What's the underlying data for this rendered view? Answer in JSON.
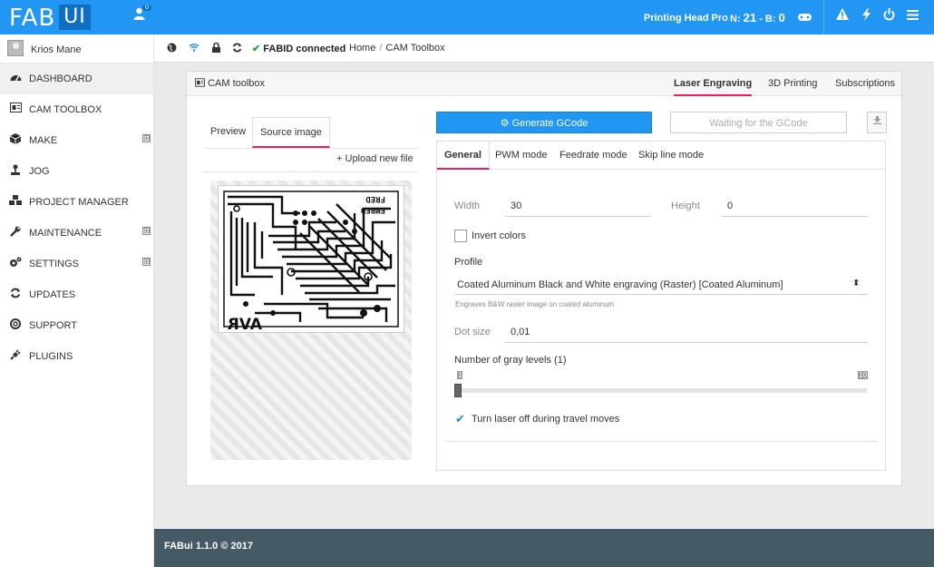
{
  "header": {
    "logo_main": "FAB",
    "logo_ui": "UI",
    "notification_count": "0",
    "head_name": "Printing Head Pro",
    "temp_n_label": "N:",
    "temp_n_value": "21",
    "temp_b_label": "B:",
    "temp_b_value": "0"
  },
  "sidebar": {
    "user_name": "Krios Mane",
    "items": [
      {
        "label": "DASHBOARD",
        "icon": "dashboard-icon",
        "expandable": false
      },
      {
        "label": "CAM TOOLBOX",
        "icon": "cam-toolbox-icon",
        "expandable": false
      },
      {
        "label": "MAKE",
        "icon": "cube-icon",
        "expandable": true
      },
      {
        "label": "JOG",
        "icon": "joystick-icon",
        "expandable": false
      },
      {
        "label": "PROJECT MANAGER",
        "icon": "cubes-icon",
        "expandable": false
      },
      {
        "label": "MAINTENANCE",
        "icon": "wrench-icon",
        "expandable": true
      },
      {
        "label": "SETTINGS",
        "icon": "cogs-icon",
        "expandable": true
      },
      {
        "label": "UPDATES",
        "icon": "refresh-icon",
        "expandable": false
      },
      {
        "label": "SUPPORT",
        "icon": "lifebuoy-icon",
        "expandable": false
      },
      {
        "label": "PLUGINS",
        "icon": "plug-icon",
        "expandable": false
      }
    ],
    "expand_glyph": "⊞"
  },
  "crumbbar": {
    "fabid": "FABID connected",
    "crumbs": [
      "Home",
      "CAM Toolbox"
    ]
  },
  "panel": {
    "title": "CAM toolbox",
    "tabs": [
      "Laser Engraving",
      "3D Printing",
      "Subscriptions"
    ],
    "active_tab": "Laser Engraving"
  },
  "left": {
    "tabs": [
      "Preview",
      "Source image"
    ],
    "upload_label": "Upload new file"
  },
  "actions": {
    "generate": "Generate GCode",
    "waiting": "Waiting for the GCode"
  },
  "settings": {
    "tabs": [
      "General",
      "PWM mode",
      "Feedrate mode",
      "Skip line mode"
    ],
    "width_label": "Width",
    "width_value": "30",
    "height_label": "Height",
    "height_value": "0",
    "invert_label": "Invert colors",
    "invert_checked": false,
    "profile_label": "Profile",
    "profile_value": "Coated Aluminum Black and White engraving (Raster) [Coated Aluminum]",
    "profile_hint": "Engraves B&W raster image on coated aluminum",
    "dot_label": "Dot size",
    "dot_value": "0,01",
    "gray_label": "Number of gray levels (1)",
    "gray_min": "1",
    "gray_max": "10",
    "gray_value": 1,
    "laser_off_label": "Turn laser off during travel moves",
    "laser_off_checked": true
  },
  "footer": {
    "text": "FABui 1.1.0 © 2017"
  },
  "colors": {
    "primary": "#2196f3",
    "accent_underline": "#e91e63",
    "footer": "#455a64",
    "success": "#2a9d3a"
  }
}
